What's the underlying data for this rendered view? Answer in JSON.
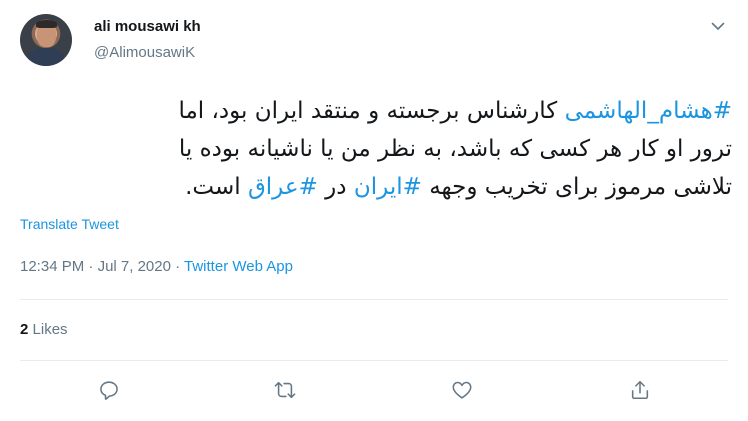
{
  "user": {
    "name": "ali mousawi kh",
    "handle": "@AlimousawiK"
  },
  "tweet": {
    "line1": {
      "tag": "#هشام_الهاشمی",
      "text": " کارشناس برجسته و منتقد ایران بود، اما"
    },
    "line2": "ترور او کار هر کسی که باشد، به نظر من یا ناشیانه بوده یا",
    "line3": {
      "pre": "تلاشی مرموز برای تخریب وجهه ",
      "tag1": "#ایران",
      "mid": " در ",
      "tag2": "#عراق",
      "post": " است."
    }
  },
  "translate_label": "Translate Tweet",
  "meta": {
    "time": "12:34 PM",
    "sep1": " · ",
    "date": "Jul 7, 2020",
    "sep2": " · ",
    "source": "Twitter Web App"
  },
  "stats": {
    "likes_count": "2",
    "likes_label": "Likes"
  },
  "icons": {
    "menu": "chevron-down-icon",
    "reply": "reply-icon",
    "retweet": "retweet-icon",
    "like": "heart-icon",
    "share": "share-icon"
  },
  "colors": {
    "accent": "#1b95e0",
    "secondary_text": "#657786",
    "icon": "#657786",
    "divider": "#e6ecf0"
  }
}
